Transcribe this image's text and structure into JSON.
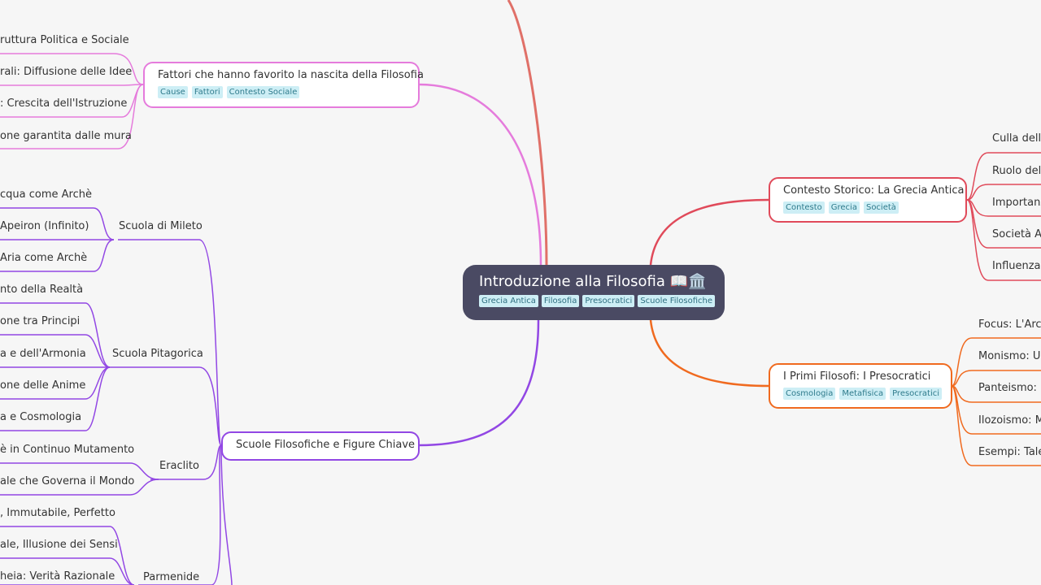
{
  "root": {
    "title": "Introduzione alla Filosofia 📖🏛️",
    "tags": [
      "Grecia Antica",
      "Filosofia",
      "Presocratici",
      "Scuole Filosofiche"
    ]
  },
  "fattori": {
    "title": "Fattori che hanno favorito la nascita della Filosofia",
    "tags": [
      "Cause",
      "Fattori",
      "Contesto Sociale"
    ],
    "leaves": [
      "ruttura Politica e Sociale",
      "rali: Diffusione delle Idee",
      ": Crescita dell'Istruzione",
      "one garantita dalle mura"
    ]
  },
  "scuole": {
    "title": "Scuole Filosofiche e Figure Chiave",
    "mileto": {
      "label": "Scuola di Mileto",
      "leaves": [
        "cqua come Archè",
        "Apeiron (Infinito)",
        "Aria come Archè"
      ]
    },
    "pitagorica": {
      "label": "Scuola Pitagorica",
      "leaves": [
        "nto della Realtà",
        "one tra Principi",
        "a e dell'Armonia",
        "one delle Anime",
        "a e Cosmologia"
      ]
    },
    "eraclito": {
      "label": "Eraclito",
      "leaves": [
        "è in Continuo Mutamento",
        "ale che Governa il Mondo"
      ]
    },
    "parmenide": {
      "label": "Parmenide",
      "leaves": [
        ", Immutabile, Perfetto",
        "ale, Illusione dei Sensi",
        "heia: Verità Razionale"
      ]
    }
  },
  "contesto": {
    "title": "Contesto Storico:  La Grecia Antica",
    "tags": [
      "Contesto",
      "Grecia",
      "Società"
    ],
    "leaves": [
      "Culla della",
      "Ruolo dell",
      "Importanz",
      "Società Ap",
      "Influenza c"
    ]
  },
  "primi": {
    "title": "I Primi Filosofi: I Presocratici",
    "tags": [
      "Cosmologia",
      "Metafisica",
      "Presocratici"
    ],
    "leaves": [
      "Focus: L'Arch",
      "Monismo: Un",
      "Panteismo: D",
      "Ilozoismo: Ma",
      "Esempi: Talet"
    ]
  },
  "colors": {
    "pink": "#e57bdc",
    "purple": "#9247e4",
    "red": "#e04a5a",
    "orange": "#f06a1f",
    "salmon": "#e07068",
    "root": "#4a4a63"
  }
}
